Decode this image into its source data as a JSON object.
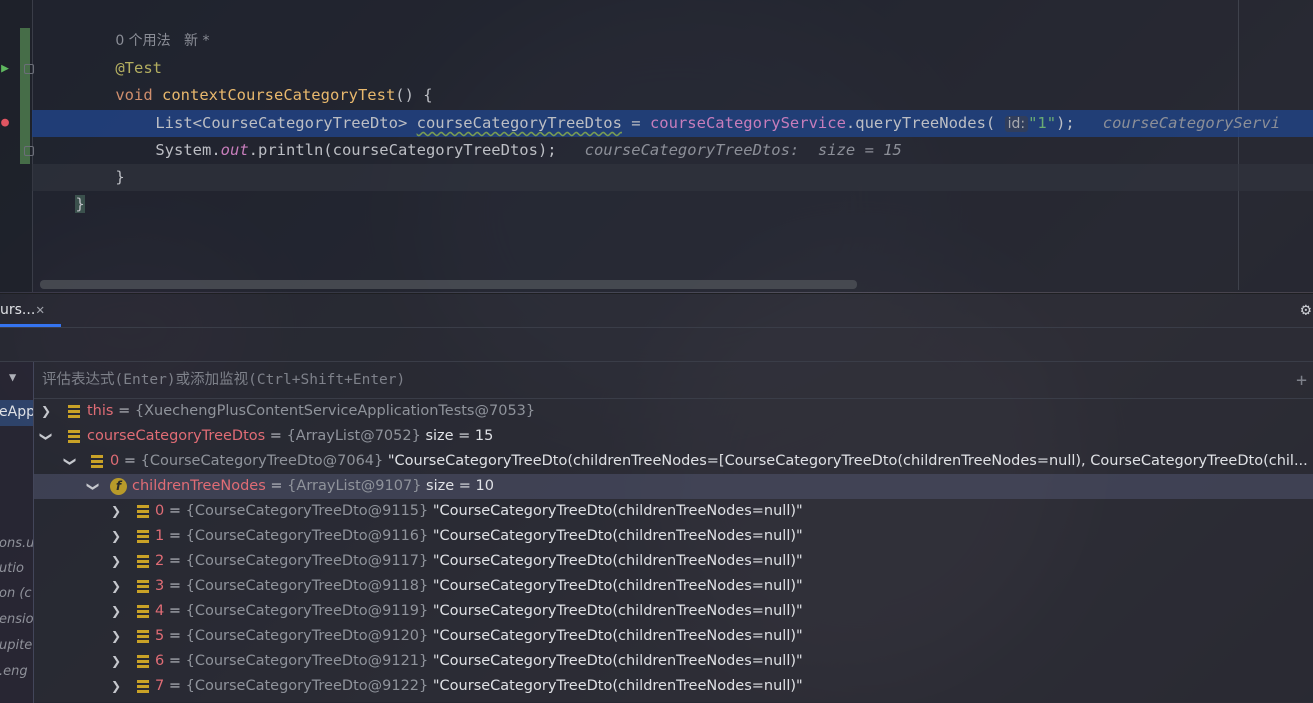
{
  "editor": {
    "usage_hint": "0 个用法   新 *",
    "annotation": "@Test",
    "line3": {
      "kw": "void",
      "method": "contextCourseCategoryTest",
      "rest": "() {"
    },
    "line4": {
      "type": "List<CourseCategoryTreeDto>",
      "var": "courseCategoryTreeDtos",
      "eq": " = ",
      "service": "courseCategoryService",
      "call": ".queryTreeNodes(",
      "param_hint": "id:",
      "arg": "\"1\"",
      "end": ");",
      "inline": "courseCategoryServi"
    },
    "line5": {
      "cls": "System.",
      "field": "out",
      "call": ".println(courseCategoryTreeDtos);",
      "inline": "courseCategoryTreeDtos:  size = 15"
    },
    "line6": "}",
    "line7": "}"
  },
  "debug": {
    "tab_label": "urs...",
    "tab_close": "✕",
    "eval_placeholder": "评估表达式(Enter)或添加监视(Ctrl+Shift+Enter)",
    "frames": [
      {
        "label": "eApp",
        "selected": true
      },
      {
        "label": "ons.u"
      },
      {
        "label": "utio"
      },
      {
        "label": "on (c"
      },
      {
        "label": "ensio"
      },
      {
        "label": "upite"
      },
      {
        "label": ".eng"
      }
    ],
    "variables": [
      {
        "name": "this",
        "type": "{XuechengPlusContentServiceApplicationTests@7053}",
        "value": ""
      },
      {
        "name": "courseCategoryTreeDtos",
        "type": "{ArrayList@7052}",
        "value": "size = 15"
      },
      {
        "name": "0",
        "type": "{CourseCategoryTreeDto@7064}",
        "value": "\"CourseCategoryTreeDto(childrenTreeNodes=[CourseCategoryTreeDto(childrenTreeNodes=null), CourseCategoryTreeDto(chil..."
      },
      {
        "name": "childrenTreeNodes",
        "type": "{ArrayList@9107}",
        "value": "size = 10"
      },
      {
        "name": "0",
        "type": "{CourseCategoryTreeDto@9115}",
        "value": "\"CourseCategoryTreeDto(childrenTreeNodes=null)\""
      },
      {
        "name": "1",
        "type": "{CourseCategoryTreeDto@9116}",
        "value": "\"CourseCategoryTreeDto(childrenTreeNodes=null)\""
      },
      {
        "name": "2",
        "type": "{CourseCategoryTreeDto@9117}",
        "value": "\"CourseCategoryTreeDto(childrenTreeNodes=null)\""
      },
      {
        "name": "3",
        "type": "{CourseCategoryTreeDto@9118}",
        "value": "\"CourseCategoryTreeDto(childrenTreeNodes=null)\""
      },
      {
        "name": "4",
        "type": "{CourseCategoryTreeDto@9119}",
        "value": "\"CourseCategoryTreeDto(childrenTreeNodes=null)\""
      },
      {
        "name": "5",
        "type": "{CourseCategoryTreeDto@9120}",
        "value": "\"CourseCategoryTreeDto(childrenTreeNodes=null)\""
      },
      {
        "name": "6",
        "type": "{CourseCategoryTreeDto@9121}",
        "value": "\"CourseCategoryTreeDto(childrenTreeNodes=null)\""
      },
      {
        "name": "7",
        "type": "{CourseCategoryTreeDto@9122}",
        "value": "\"CourseCategoryTreeDto(childrenTreeNodes=null)\""
      }
    ]
  }
}
